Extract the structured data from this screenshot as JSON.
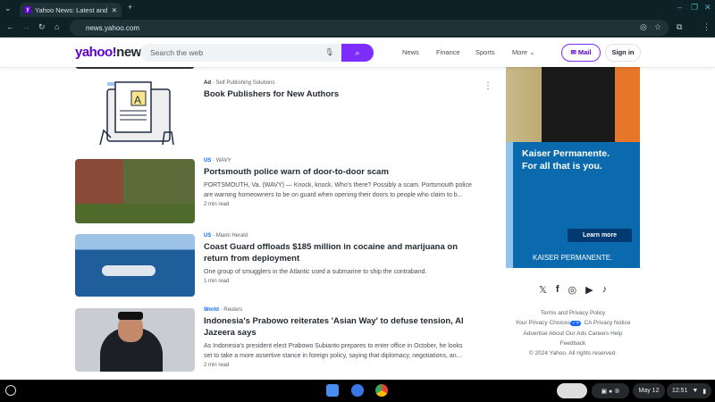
{
  "browser": {
    "tab_title": "Yahoo News: Latest and Breaki",
    "url": "news.yahoo.com"
  },
  "header": {
    "logo_main": "yahoo!",
    "logo_sub": "news",
    "search_placeholder": "Search the web",
    "nav": [
      "News",
      "Finance",
      "Sports",
      "More"
    ],
    "mail": "Mail",
    "signin": "Sign in"
  },
  "articles": [
    {
      "category": "Ad",
      "source": "Self Publishing Solutions",
      "title": "Book Publishers for New Authors"
    },
    {
      "category": "US",
      "source": "WAVY",
      "title": "Portsmouth police warn of door-to-door scam",
      "summary": "PORTSMOUTH, Va. (WAVY) — Knock, knock. Who's there? Possibly a scam. Portsmouth police are warning homeowners to be on guard when opening their doors to people who claim to b...",
      "read": "2 min read"
    },
    {
      "category": "US",
      "source": "Miami Herald",
      "title": "Coast Guard offloads $185 million in cocaine and marijuana on return from deployment",
      "summary": "One group of smugglers in the Atlantic used a submarine to ship the contraband.",
      "read": "1 min read"
    },
    {
      "category": "World",
      "source": "Reuters",
      "title": "Indonesia's Prabowo reiterates 'Asian Way' to defuse tension, Al Jazeera says",
      "summary": "As Indonesia's president elect Prabowo Subianto prepares to enter office in October, he looks set to take a more assertive stance in foreign policy, saying that diplomacy, negotiations, an...",
      "read": "2 min read"
    }
  ],
  "ad": {
    "headline1": "Kaiser Permanente.",
    "headline2": "For all that is you.",
    "cta": "Learn more",
    "brand": "KAISER PERMANENTE."
  },
  "footer": {
    "links1": "Terms and Privacy Policy",
    "privacy": "Your Privacy Choices",
    "ca": "CA Privacy Notice",
    "links3": [
      "Advertise",
      "About Our Ads",
      "Careers",
      "Help"
    ],
    "feedback": "Feedback",
    "copyright": "© 2024 Yahoo. All rights reserved."
  },
  "taskbar": {
    "date": "May 12",
    "time": "12:51"
  }
}
